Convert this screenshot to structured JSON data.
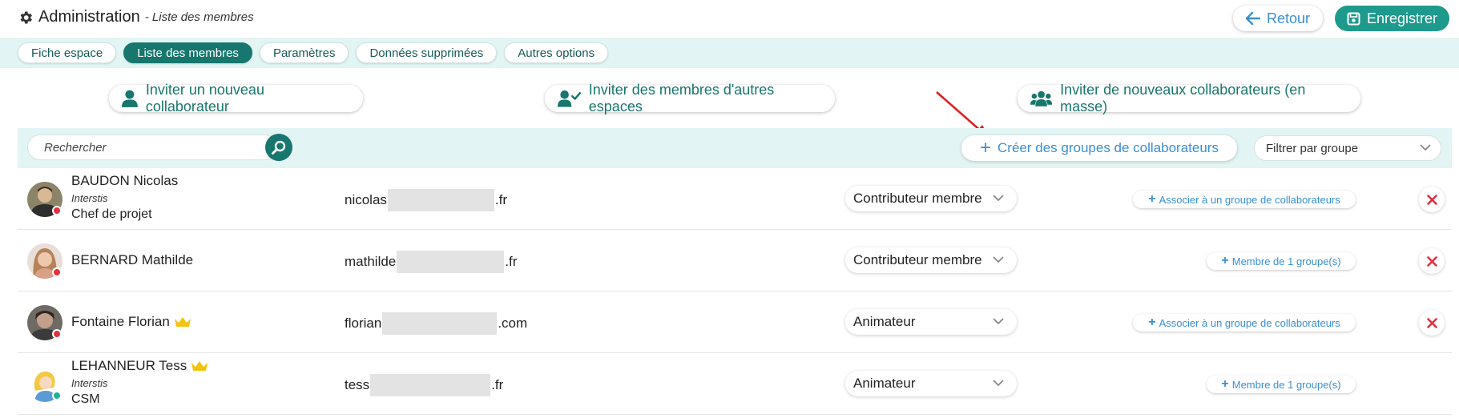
{
  "header": {
    "title": "Administration",
    "subtitle": "Liste des membres",
    "back_label": "Retour",
    "save_label": "Enregistrer"
  },
  "tabs": [
    {
      "label": "Fiche espace",
      "active": false
    },
    {
      "label": "Liste des membres",
      "active": true
    },
    {
      "label": "Paramètres",
      "active": false
    },
    {
      "label": "Données supprimées",
      "active": false
    },
    {
      "label": "Autres options",
      "active": false
    }
  ],
  "invite": {
    "single": "Inviter un nouveau collaborateur",
    "other_spaces": "Inviter des membres d'autres espaces",
    "bulk": "Inviter de nouveaux collaborateurs (en masse)"
  },
  "toolbar": {
    "search_placeholder": "Rechercher",
    "create_groups": "Créer des groupes de collaborateurs",
    "filter_label": "Filtrer par groupe"
  },
  "members": [
    {
      "name": "BAUDON Nicolas",
      "company": "Interstis",
      "job": "Chef de projet",
      "email_prefix": "nicolas",
      "email_suffix": ".fr",
      "role": "Contributeur membre",
      "group": "Associer à un groupe de collaborateurs",
      "status": "offline",
      "admin": false,
      "deletable": true
    },
    {
      "name": "BERNARD Mathilde",
      "company": "",
      "job": "",
      "email_prefix": "mathilde",
      "email_suffix": ".fr",
      "role": "Contributeur membre",
      "group": "Membre de 1 groupe(s)",
      "status": "offline",
      "admin": false,
      "deletable": true
    },
    {
      "name": "Fontaine Florian",
      "company": "",
      "job": "",
      "email_prefix": "florian",
      "email_suffix": ".com",
      "role": "Animateur",
      "group": "Associer à un groupe de collaborateurs",
      "status": "offline",
      "admin": true,
      "deletable": true
    },
    {
      "name": "LEHANNEUR Tess",
      "company": "Interstis",
      "job": "CSM",
      "email_prefix": "tess",
      "email_suffix": ".fr",
      "role": "Animateur",
      "group": "Membre de 1 groupe(s)",
      "status": "online",
      "admin": true,
      "deletable": false
    }
  ],
  "colors": {
    "brand": "#17766d",
    "accent_blue": "#3a8fd0",
    "tab_bg": "#e2f4f4",
    "status_offline": "#e0313f",
    "status_online": "#1eb39a",
    "crown": "#f2c40f",
    "delete": "#e0313f"
  }
}
